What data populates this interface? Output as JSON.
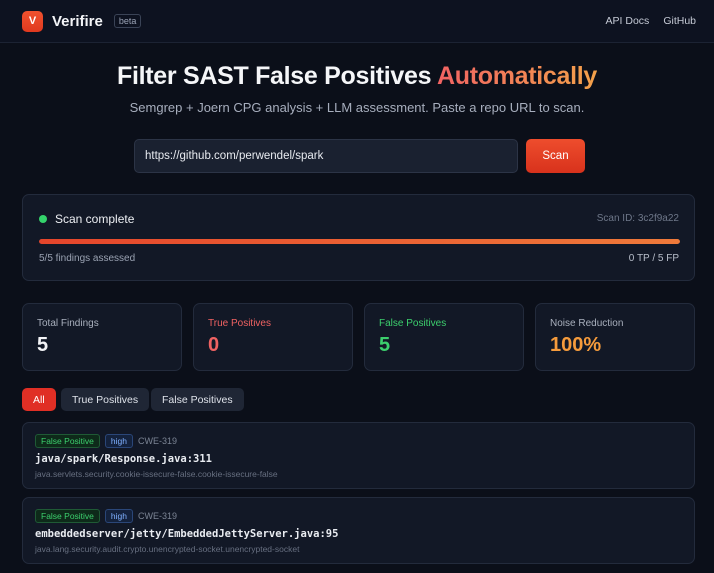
{
  "header": {
    "logo_letter": "V",
    "brand": "Verifire",
    "beta": "beta",
    "nav": [
      "API Docs",
      "GitHub"
    ]
  },
  "hero": {
    "title_main": "Filter SAST False Positives ",
    "title_accent": "Automatically",
    "subtitle": "Semgrep + Joern CPG analysis + LLM assessment. Paste a repo URL to scan.",
    "url_value": "https://github.com/perwendel/spark",
    "scan_label": "Scan"
  },
  "status": {
    "label": "Scan complete",
    "scan_id": "Scan ID: 3c2f9a22",
    "progress": 1.0,
    "assessed": "5/5 findings assessed",
    "tpfp": "0 TP / 5 FP"
  },
  "stats": [
    {
      "label": "Total Findings",
      "value": "5"
    },
    {
      "label": "True Positives",
      "value": "0"
    },
    {
      "label": "False Positives",
      "value": "5"
    },
    {
      "label": "Noise Reduction",
      "value": "100%"
    }
  ],
  "filters": [
    "All",
    "True Positives",
    "False Positives"
  ],
  "findings": [
    {
      "verdict": "False Positive",
      "severity": "high",
      "cwe": "CWE-319",
      "path": "java/spark/Response.java:311",
      "rule": "java.servlets.security.cookie-issecure-false.cookie-issecure-false"
    },
    {
      "verdict": "False Positive",
      "severity": "high",
      "cwe": "CWE-319",
      "path": "embeddedserver/jetty/EmbeddedJettyServer.java:95",
      "rule": "java.lang.security.audit.crypto.unencrypted-socket.unencrypted-socket"
    }
  ],
  "colors": {
    "accent": "#e0391f",
    "success": "#34d36b",
    "danger": "#ef6262",
    "warning": "#f59b3c"
  }
}
